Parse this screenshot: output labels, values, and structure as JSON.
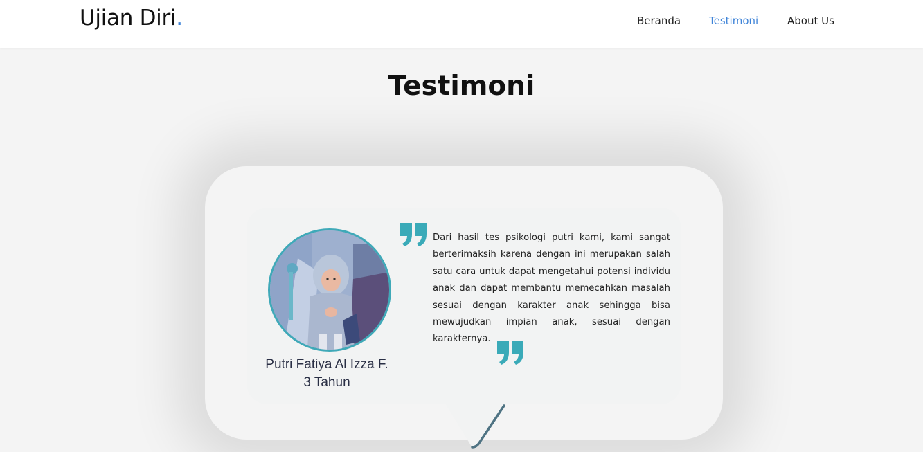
{
  "header": {
    "brand": "Ujian Diri",
    "brand_dot": ".",
    "nav": [
      {
        "label": "Beranda",
        "active": false
      },
      {
        "label": "Testimoni",
        "active": true
      },
      {
        "label": "About Us",
        "active": false
      }
    ]
  },
  "main": {
    "title": "Testimoni",
    "testimonial": {
      "name": "Putri Fatiya Al Izza F.",
      "age": "3 Tahun",
      "text": "Dari hasil tes psikologi putri kami, kami sangat berterimaksih karena dengan ini merupakan salah satu cara untuk dapat mengetahui potensi individu anak dan dapat membantu memecahkan masalah sesuai dengan karakter anak sehingga bisa mewujudkan impian anak, sesuai dengan karakternya.",
      "quote_color": "#3aaab8"
    }
  },
  "colors": {
    "accent": "#3f84d8",
    "background": "#f4f4f4"
  }
}
